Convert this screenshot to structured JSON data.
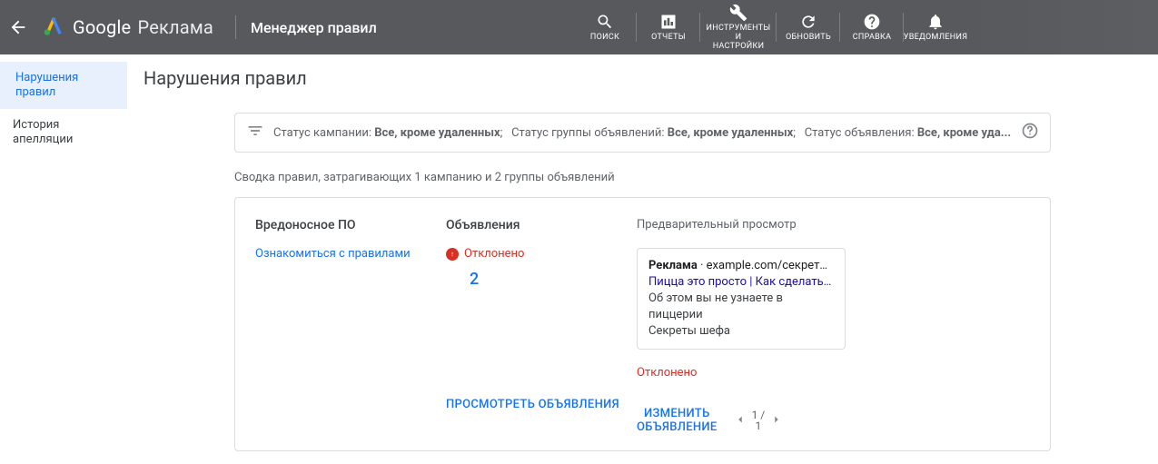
{
  "header": {
    "product_google": "Google",
    "product_ads": "Реклама",
    "section": "Менеджер правил",
    "tools": {
      "search": "ПОИСК",
      "reports": "ОТЧЕТЫ",
      "tools_settings_l1": "ИНСТРУМЕНТЫ",
      "tools_settings_l2": "И",
      "tools_settings_l3": "НАСТРОЙКИ",
      "refresh": "ОБНОВИТЬ",
      "help": "СПРАВКА",
      "notifications": "УВЕДОМЛЕНИЯ"
    }
  },
  "sidebar": {
    "items": [
      {
        "label": "Нарушения правил",
        "active": true
      },
      {
        "label": "История апелляции",
        "active": false
      }
    ]
  },
  "page": {
    "title": "Нарушения правил"
  },
  "filter": {
    "seg1_label": "Статус кампании: ",
    "seg1_value": "Все, кроме удаленных",
    "seg2_label": "Статус группы объявлений: ",
    "seg2_value": "Все, кроме удаленных",
    "seg3_label": "Статус объявления: ",
    "seg3_value": "Все, кроме уда..."
  },
  "summary": "Сводка правил, затрагивающих 1 кампанию и 2 группы объявлений",
  "card": {
    "policy_title": "Вредоносное ПО",
    "policy_link": "Ознакомиться с правилами",
    "ads_title": "Объявления",
    "ads_status": "Отклонено",
    "ads_count": "2",
    "preview_label": "Предварительный просмотр",
    "ad": {
      "badge": "Реклама",
      "dot": " · ",
      "url": "example.com/секреты_пи...",
      "headline": "Пицца это просто | Как сделать вкус...",
      "desc1": "Об этом вы не узнаете в пиццерии",
      "desc2": "Секреты шефа"
    },
    "rejected_label": "Отклонено",
    "view_ads_btn": "ПРОСМОТРЕТЬ ОБЪЯВЛЕНИЯ",
    "edit_ad_btn_l1": "ИЗМЕНИТЬ",
    "edit_ad_btn_l2": "ОБЪЯВЛЕНИЕ",
    "pager_current": "1 /",
    "pager_total": "1"
  }
}
